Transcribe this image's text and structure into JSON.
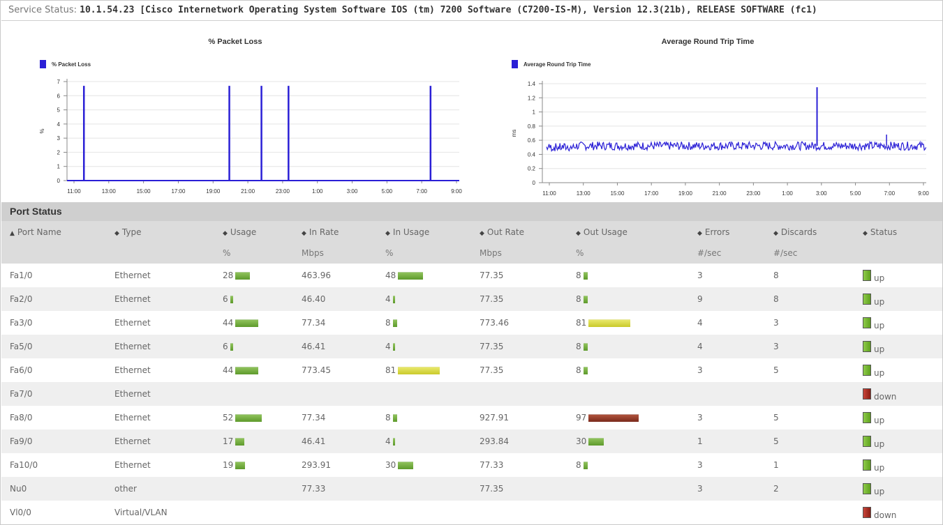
{
  "header": {
    "label": "Service Status:",
    "value": "10.1.54.23 [Cisco Internetwork Operating System Software IOS (tm) 7200 Software (C7200-IS-M), Version 12.3(21b), RELEASE SOFTWARE (fc1)"
  },
  "colors": {
    "series": "#2a1fd6",
    "up": "#6fb52e",
    "down": "#a8261a",
    "bar_green": "#6fa83c",
    "bar_yellow": "#d8d83f",
    "bar_red": "#8b3322"
  },
  "chart_data": [
    {
      "type": "line",
      "title": "% Packet Loss",
      "legend": "% Packet Loss",
      "ylabel": "%",
      "xlabel": "",
      "ylim": [
        0,
        7
      ],
      "yticks": [
        "0",
        "1",
        "2",
        "3",
        "4",
        "5",
        "6",
        "7"
      ],
      "xticks": [
        "11:00",
        "13:00",
        "15:00",
        "17:00",
        "19:00",
        "21:00",
        "23:00",
        "1:00",
        "3:00",
        "5:00",
        "7:00",
        "9:00"
      ],
      "series": [
        {
          "name": "% Packet Loss",
          "spikes_at_hours": [
            11.5,
            20.1,
            22.0,
            23.6,
            32.0
          ],
          "spike_value": 6.7,
          "baseline": 0
        }
      ],
      "grid": true,
      "legend_position": "top-left"
    },
    {
      "type": "line",
      "title": "Average Round Trip Time",
      "legend": "Average Round Trip Time",
      "ylabel": "ms",
      "xlabel": "",
      "ylim": [
        0,
        1.4
      ],
      "yticks": [
        "0",
        "0.2",
        "0.4",
        "0.6",
        "0.8",
        "1",
        "1.2",
        "1.4"
      ],
      "xticks": [
        "11:00",
        "13:00",
        "15:00",
        "17:00",
        "19:00",
        "21:00",
        "23:00",
        "1:00",
        "3:00",
        "5:00",
        "7:00",
        "9:00"
      ],
      "series": [
        {
          "name": "Average Round Trip Time",
          "baseline": 0.52,
          "noise": 0.06,
          "spike_at_hour": 27.1,
          "spike_value": 1.35,
          "minor_spike_at_hour": 31.3,
          "minor_spike_value": 0.68
        }
      ],
      "grid": true,
      "legend_position": "top-left"
    }
  ],
  "port_status": {
    "title": "Port Status",
    "columns": [
      {
        "label": "Port Name",
        "unit": "",
        "sort": "▲"
      },
      {
        "label": "Type",
        "unit": "",
        "sort": "◆"
      },
      {
        "label": "Usage",
        "unit": "%",
        "sort": "◆"
      },
      {
        "label": "In Rate",
        "unit": "Mbps",
        "sort": "◆"
      },
      {
        "label": "In Usage",
        "unit": "%",
        "sort": "◆"
      },
      {
        "label": "Out Rate",
        "unit": "Mbps",
        "sort": "◆"
      },
      {
        "label": "Out Usage",
        "unit": "%",
        "sort": "◆"
      },
      {
        "label": "Errors",
        "unit": "#/sec",
        "sort": "◆"
      },
      {
        "label": "Discards",
        "unit": "#/sec",
        "sort": "◆"
      },
      {
        "label": "Status",
        "unit": "",
        "sort": "◆"
      }
    ],
    "rows": [
      {
        "port": "Fa1/0",
        "type": "Ethernet",
        "usage": "28",
        "in_rate": "463.96",
        "in_usage": "48",
        "out_rate": "77.35",
        "out_usage": "8",
        "errors": "3",
        "discards": "8",
        "status": "up"
      },
      {
        "port": "Fa2/0",
        "type": "Ethernet",
        "usage": "6",
        "in_rate": "46.40",
        "in_usage": "4",
        "out_rate": "77.35",
        "out_usage": "8",
        "errors": "9",
        "discards": "8",
        "status": "up"
      },
      {
        "port": "Fa3/0",
        "type": "Ethernet",
        "usage": "44",
        "in_rate": "77.34",
        "in_usage": "8",
        "out_rate": "773.46",
        "out_usage": "81",
        "errors": "4",
        "discards": "3",
        "status": "up"
      },
      {
        "port": "Fa5/0",
        "type": "Ethernet",
        "usage": "6",
        "in_rate": "46.41",
        "in_usage": "4",
        "out_rate": "77.35",
        "out_usage": "8",
        "errors": "4",
        "discards": "3",
        "status": "up"
      },
      {
        "port": "Fa6/0",
        "type": "Ethernet",
        "usage": "44",
        "in_rate": "773.45",
        "in_usage": "81",
        "out_rate": "77.35",
        "out_usage": "8",
        "errors": "3",
        "discards": "5",
        "status": "up"
      },
      {
        "port": "Fa7/0",
        "type": "Ethernet",
        "usage": "",
        "in_rate": "",
        "in_usage": "",
        "out_rate": "",
        "out_usage": "",
        "errors": "",
        "discards": "",
        "status": "down"
      },
      {
        "port": "Fa8/0",
        "type": "Ethernet",
        "usage": "52",
        "in_rate": "77.34",
        "in_usage": "8",
        "out_rate": "927.91",
        "out_usage": "97",
        "errors": "3",
        "discards": "5",
        "status": "up"
      },
      {
        "port": "Fa9/0",
        "type": "Ethernet",
        "usage": "17",
        "in_rate": "46.41",
        "in_usage": "4",
        "out_rate": "293.84",
        "out_usage": "30",
        "errors": "1",
        "discards": "5",
        "status": "up"
      },
      {
        "port": "Fa10/0",
        "type": "Ethernet",
        "usage": "19",
        "in_rate": "293.91",
        "in_usage": "30",
        "out_rate": "77.33",
        "out_usage": "8",
        "errors": "3",
        "discards": "1",
        "status": "up"
      },
      {
        "port": "Nu0",
        "type": "other",
        "usage": "",
        "in_rate": "77.33",
        "in_usage": "",
        "out_rate": "77.35",
        "out_usage": "",
        "errors": "3",
        "discards": "2",
        "status": "up"
      },
      {
        "port": "Vl0/0",
        "type": "Virtual/VLAN",
        "usage": "",
        "in_rate": "",
        "in_usage": "",
        "out_rate": "",
        "out_usage": "",
        "errors": "",
        "discards": "",
        "status": "down"
      }
    ]
  }
}
